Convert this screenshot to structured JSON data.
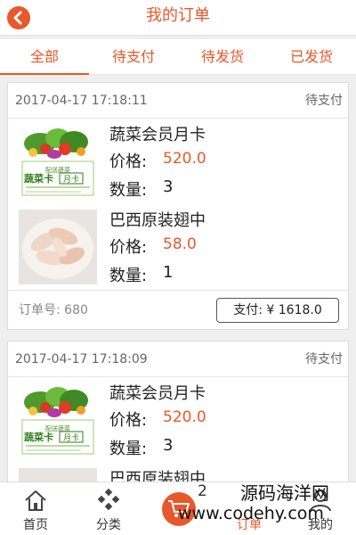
{
  "header": {
    "title": "我的订单"
  },
  "tabs": [
    {
      "label": "全部"
    },
    {
      "label": "待支付"
    },
    {
      "label": "待发货"
    },
    {
      "label": "已发货"
    }
  ],
  "orders": [
    {
      "time": "2017-04-17 17:18:11",
      "status": "待支付",
      "items": [
        {
          "name": "蔬菜会员月卡",
          "price_label": "价格:",
          "price": "520.0",
          "qty_label": "数量:",
          "qty": "3"
        },
        {
          "name": "巴西原装翅中",
          "price_label": "价格:",
          "price": "58.0",
          "qty_label": "数量:",
          "qty": "1"
        }
      ],
      "order_no": "订单号: 680",
      "pay_label": "支付: ¥ 1618.0"
    },
    {
      "time": "2017-04-17 17:18:09",
      "status": "待支付",
      "items": [
        {
          "name": "蔬菜会员月卡",
          "price_label": "价格:",
          "price": "520.0",
          "qty_label": "数量:",
          "qty": "3"
        },
        {
          "name": "巴西原装翅中"
        }
      ]
    }
  ],
  "veg_card": {
    "brand": "蔬菜卡",
    "badge": "月卡",
    "tag": "配送蔬菜"
  },
  "bottom_nav": [
    {
      "label": "首页",
      "icon": "home-icon"
    },
    {
      "label": "分类",
      "icon": "category-icon"
    },
    {
      "label": "订单",
      "icon": "cart-icon",
      "badge": "2"
    },
    {
      "label": "我的",
      "icon": "user-icon"
    }
  ],
  "watermark": {
    "line1": "源码海洋网",
    "line2": "www.codehy.com"
  },
  "colors": {
    "accent": "#e8582a",
    "text": "#333333",
    "muted": "#888888"
  }
}
